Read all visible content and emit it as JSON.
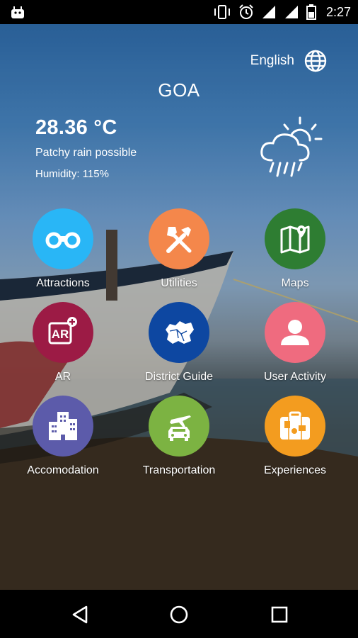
{
  "status_bar": {
    "time": "2:27",
    "icons": [
      "android-icon",
      "vibrate-icon",
      "alarm-icon",
      "signal-icon",
      "wifi-icon",
      "battery-icon"
    ]
  },
  "header": {
    "language_label": "English",
    "language_icon": "globe-icon",
    "city": "GOA"
  },
  "weather": {
    "temperature": "28.36 °C",
    "condition": "Patchy rain possible",
    "humidity": "Humidity: 115%",
    "icon": "rain-sun-icon"
  },
  "tiles": [
    {
      "label": "Attractions",
      "color": "#29b6f6",
      "icon": "binoculars-icon"
    },
    {
      "label": "Utilities",
      "color": "#f4874b",
      "icon": "tools-icon"
    },
    {
      "label": "Maps",
      "color": "#2e7d32",
      "icon": "map-icon"
    },
    {
      "label": "AR",
      "color": "#9c1b45",
      "icon": "ar-icon"
    },
    {
      "label": "District Guide",
      "color": "#0d47a1",
      "icon": "district-map-icon"
    },
    {
      "label": "User Activity",
      "color": "#ef6b7f",
      "icon": "user-icon"
    },
    {
      "label": "Accomodation",
      "color": "#5c5baa",
      "icon": "building-icon"
    },
    {
      "label": "Transportation",
      "color": "#7cb342",
      "icon": "transport-icon"
    },
    {
      "label": "Experiences",
      "color": "#f39c1f",
      "icon": "luggage-icon"
    }
  ],
  "nav_bar": {
    "buttons": [
      "back-icon",
      "home-icon",
      "recents-icon"
    ]
  }
}
